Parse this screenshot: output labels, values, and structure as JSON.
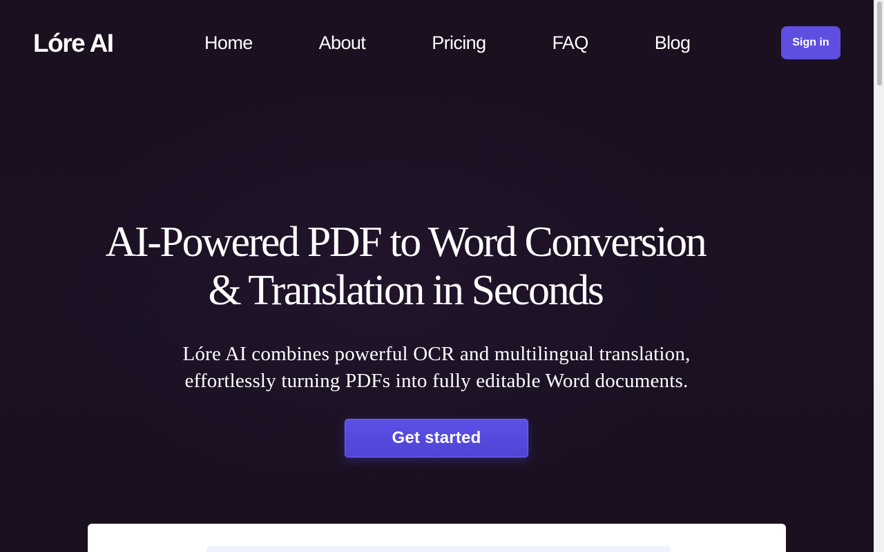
{
  "header": {
    "logo": "Lóre AI",
    "nav": [
      {
        "label": "Home"
      },
      {
        "label": "About"
      },
      {
        "label": "Pricing"
      },
      {
        "label": "FAQ"
      },
      {
        "label": "Blog"
      }
    ],
    "signin_label": "Sign in"
  },
  "hero": {
    "title_line1": "AI-Powered PDF to Word Conversion",
    "title_line2": "& Translation in Seconds",
    "subtitle_line1": "Lóre AI combines powerful OCR and multilingual translation,",
    "subtitle_line2": "effortlessly turning PDFs into fully editable Word documents.",
    "cta_label": "Get started"
  },
  "colors": {
    "background": "#1a1020",
    "accent": "#5f4fe0",
    "text": "#ffffff"
  }
}
